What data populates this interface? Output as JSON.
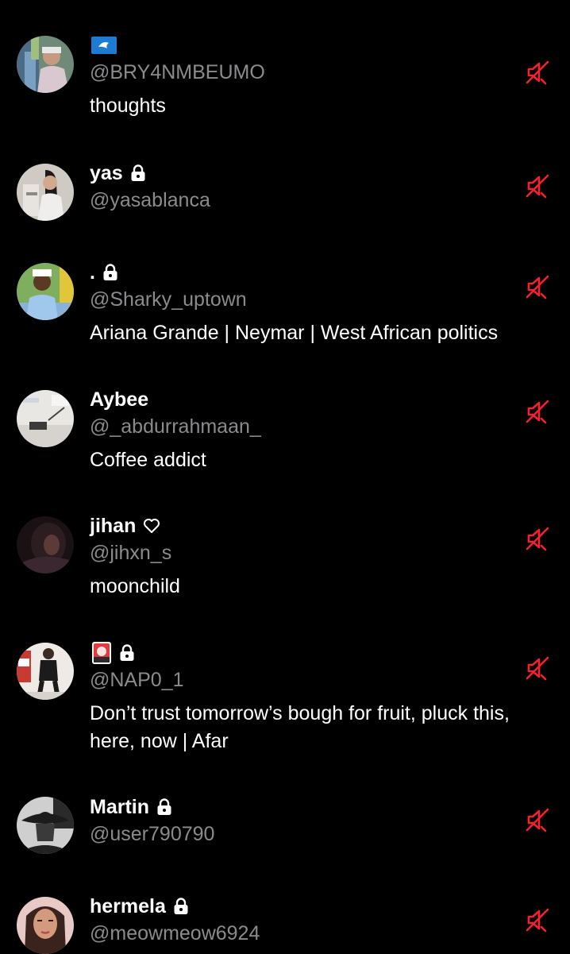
{
  "accent": {
    "mute": "#f4212e",
    "secondary_text": "#8b8b8e",
    "background": "#000000"
  },
  "users": [
    {
      "display_name": "",
      "name_icon": "flag-emoji-icon",
      "handle": "@BRY4NMBEUMO",
      "bio": "thoughts",
      "locked": false
    },
    {
      "display_name": "yas",
      "handle": "@yasablanca",
      "bio": "",
      "locked": true
    },
    {
      "display_name": ".",
      "handle": "@Sharky_uptown",
      "bio": "Ariana Grande | Neymar | West African politics",
      "locked": true
    },
    {
      "display_name": "Aybee",
      "handle": "@_abdurrahmaan_",
      "bio": "Coffee addict",
      "locked": false
    },
    {
      "display_name": "jihan",
      "name_icon": "heart-icon",
      "handle": "@jihxn_s",
      "bio": "moonchild",
      "locked": false
    },
    {
      "display_name": "",
      "name_icon": "flower-card-emoji-icon",
      "handle": "@NAP0_1",
      "bio": "Don’t trust tomorrow’s bough for fruit, pluck this, here, now | Afar",
      "locked": true
    },
    {
      "display_name": "Martin",
      "handle": "@user790790",
      "bio": "",
      "locked": true
    },
    {
      "display_name": "hermela",
      "handle": "@meowmeow6924",
      "bio": "",
      "locked": true
    }
  ]
}
